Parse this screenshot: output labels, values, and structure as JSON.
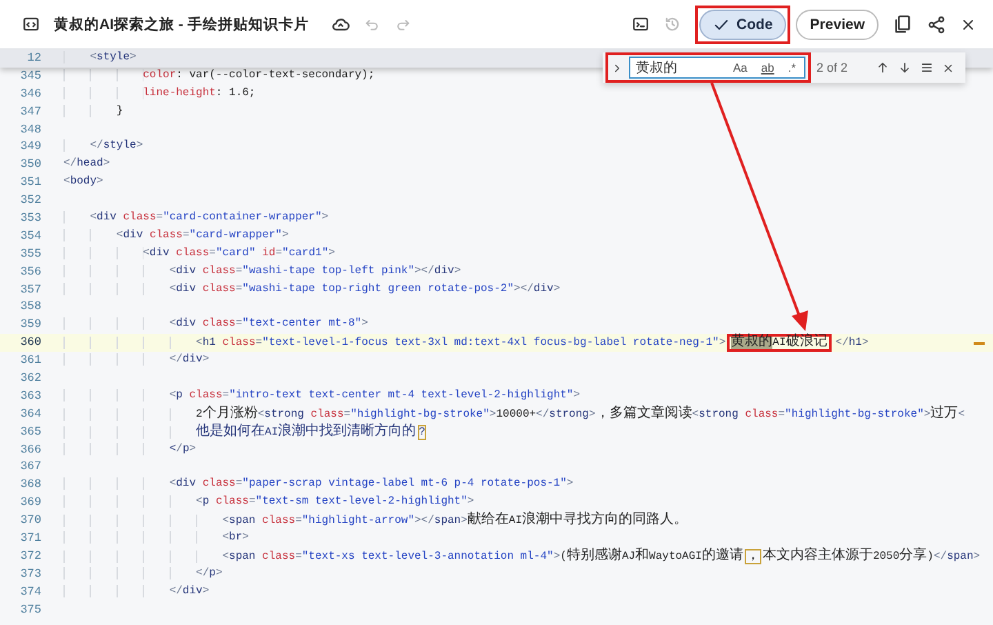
{
  "header": {
    "title": "黄叔的AI探索之旅 - 手绘拼贴知识卡片",
    "tabs": [
      {
        "label": "Code",
        "selected": true,
        "annotated": true
      },
      {
        "label": "Preview",
        "selected": false,
        "annotated": false
      }
    ]
  },
  "find": {
    "value": "黄叔的",
    "annotated": true,
    "count": "2 of 2",
    "options": [
      {
        "label": "Aa",
        "selected": false
      },
      {
        "label": "ab",
        "selected": false
      },
      {
        "label": ".*",
        "selected": false
      }
    ]
  },
  "arrow": true,
  "editor": {
    "lines": [
      {
        "number": "12",
        "kind": "html",
        "sticky": true,
        "selected": false,
        "segments": [
          {
            "kind": "code",
            "text": "    <style>"
          }
        ]
      },
      {
        "number": "345",
        "kind": "css",
        "selected": false,
        "segments": [
          {
            "kind": "code",
            "text": "            color: var(--color-text-secondary);"
          }
        ]
      },
      {
        "number": "346",
        "kind": "css",
        "selected": false,
        "segments": [
          {
            "kind": "code",
            "text": "            line-height: 1.6;"
          }
        ]
      },
      {
        "number": "347",
        "kind": "css",
        "selected": false,
        "segments": [
          {
            "kind": "code",
            "text": "        }"
          }
        ]
      },
      {
        "number": "348",
        "selected": false
      },
      {
        "number": "349",
        "kind": "html",
        "selected": false,
        "segments": [
          {
            "kind": "code",
            "text": "    </style>"
          }
        ]
      },
      {
        "number": "350",
        "kind": "html",
        "selected": false,
        "segments": [
          {
            "kind": "code",
            "text": "</head>"
          }
        ]
      },
      {
        "number": "351",
        "kind": "html",
        "selected": false,
        "segments": [
          {
            "kind": "code",
            "text": "<body>"
          }
        ]
      },
      {
        "number": "352",
        "selected": false
      },
      {
        "number": "353",
        "kind": "html",
        "selected": false,
        "segments": [
          {
            "kind": "code",
            "text": "    <div class=\"card-container-wrapper\">"
          }
        ]
      },
      {
        "number": "354",
        "kind": "html",
        "selected": false,
        "segments": [
          {
            "kind": "code",
            "text": "        <div class=\"card-wrapper\">"
          }
        ]
      },
      {
        "number": "355",
        "kind": "html",
        "selected": false,
        "segments": [
          {
            "kind": "code",
            "text": "            <div class=\"card\" id=\"card1\">"
          }
        ]
      },
      {
        "number": "356",
        "kind": "html",
        "selected": false,
        "segments": [
          {
            "kind": "code",
            "text": "                <div class=\"washi-tape top-left pink\"></div>"
          }
        ]
      },
      {
        "number": "357",
        "kind": "html",
        "selected": false,
        "segments": [
          {
            "kind": "code",
            "text": "                <div class=\"washi-tape top-right green rotate-pos-2\"></div>"
          }
        ]
      },
      {
        "number": "358",
        "selected": false
      },
      {
        "number": "359",
        "kind": "html",
        "selected": false,
        "segments": [
          {
            "kind": "code",
            "text": "                <div class=\"text-center mt-8\">"
          }
        ]
      },
      {
        "number": "360",
        "kind": "html",
        "selected": true,
        "segments": [
          {
            "kind": "code",
            "text": "                    <h1 class=\"text-level-1-focus text-3xl md:text-4xl focus-bg-label rotate-neg-1\">"
          },
          {
            "kind": "match",
            "boxed": true,
            "text": "黄叔的"
          },
          {
            "kind": "code",
            "boxed": true,
            "text": "AI破浪记"
          },
          {
            "kind": "code",
            "text": "</h1>"
          }
        ]
      },
      {
        "number": "361",
        "kind": "html",
        "selected": false,
        "segments": [
          {
            "kind": "code",
            "text": "                </div>"
          }
        ]
      },
      {
        "number": "362",
        "selected": false
      },
      {
        "number": "363",
        "kind": "html",
        "selected": false,
        "segments": [
          {
            "kind": "code",
            "text": "                <p class=\"intro-text text-center mt-4 text-level-2-highlight\">"
          }
        ]
      },
      {
        "number": "364",
        "kind": "html",
        "selected": false,
        "segments": [
          {
            "kind": "code",
            "text": "                    2个月涨粉<strong class=\"highlight-bg-stroke\">10000+</strong>，多篇文章阅读<strong class=\"highlight-bg-stroke\">过万<"
          }
        ]
      },
      {
        "number": "365",
        "kind": "html",
        "selected": false,
        "segments": [
          {
            "kind": "code",
            "text": "                    他是如何在AI浪潮中找到清晰方向的"
          },
          {
            "kind": "bracket",
            "text": "?"
          }
        ]
      },
      {
        "number": "366",
        "kind": "html",
        "selected": false,
        "segments": [
          {
            "kind": "code",
            "text": "                </p>"
          }
        ]
      },
      {
        "number": "367",
        "selected": false
      },
      {
        "number": "368",
        "kind": "html",
        "selected": false,
        "segments": [
          {
            "kind": "code",
            "text": "                <div class=\"paper-scrap vintage-label mt-6 p-4 rotate-pos-1\">"
          }
        ]
      },
      {
        "number": "369",
        "kind": "html",
        "selected": false,
        "segments": [
          {
            "kind": "code",
            "text": "                    <p class=\"text-sm text-level-2-highlight\">"
          }
        ]
      },
      {
        "number": "370",
        "kind": "html",
        "selected": false,
        "segments": [
          {
            "kind": "code",
            "text": "                        <span class=\"highlight-arrow\"></span>献给在AI浪潮中寻找方向的同路人。"
          }
        ]
      },
      {
        "number": "371",
        "kind": "html",
        "selected": false,
        "segments": [
          {
            "kind": "code",
            "text": "                        <br>"
          }
        ]
      },
      {
        "number": "372",
        "kind": "html",
        "selected": false,
        "segments": [
          {
            "kind": "code",
            "text": "                        <span class=\"text-xs text-level-3-annotation ml-4\">(特别感谢AJ和WaytoAGI的邀请"
          },
          {
            "kind": "bracket",
            "text": "，"
          },
          {
            "kind": "code",
            "text": "本文内容主体源于2050分享)</span>"
          }
        ]
      },
      {
        "number": "373",
        "kind": "html",
        "selected": false,
        "segments": [
          {
            "kind": "code",
            "text": "                    </p>"
          }
        ]
      },
      {
        "number": "374",
        "kind": "html",
        "selected": false,
        "segments": [
          {
            "kind": "code",
            "text": "                </div>"
          }
        ]
      },
      {
        "number": "375",
        "selected": false
      }
    ]
  }
}
